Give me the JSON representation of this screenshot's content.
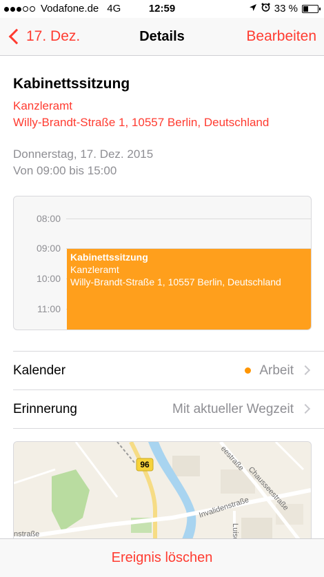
{
  "status_bar": {
    "carrier": "Vodafone.de",
    "network": "4G",
    "time": "12:59",
    "battery": "33 %",
    "battery_level": 0.33
  },
  "nav": {
    "back_label": "17. Dez.",
    "title": "Details",
    "edit_label": "Bearbeiten"
  },
  "event": {
    "title": "Kabinettssitzung",
    "location_name": "Kanzleramt",
    "address": "Willy-Brandt-Straße 1, 10557 Berlin, Deutschland",
    "date": "Donnerstag, 17. Dez. 2015",
    "time_range": "Von 09:00 bis 15:00"
  },
  "mini_calendar": {
    "hours": [
      "08:00",
      "09:00",
      "10:00",
      "11:00"
    ],
    "event_title": "Kabinettssitzung",
    "event_location": "Kanzleramt",
    "event_address": "Willy-Brandt-Straße 1, 10557 Berlin, Deutschland",
    "event_color": "#ff9f1c"
  },
  "rows": {
    "calendar_label": "Kalender",
    "calendar_value": "Arbeit",
    "calendar_color": "#ff9500",
    "reminder_label": "Erinnerung",
    "reminder_value": "Mit aktueller Wegzeit"
  },
  "map": {
    "route_badge": "96",
    "streets": [
      "Invalidenstraße",
      "Chausseestraße",
      "eestraße",
      "Luise",
      "nstraße"
    ]
  },
  "bottom": {
    "delete_label": "Ereignis löschen"
  },
  "colors": {
    "accent": "#ff3b30",
    "secondary_text": "#8e8e93"
  }
}
